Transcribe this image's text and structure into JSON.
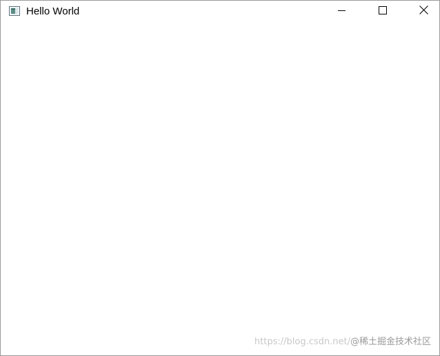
{
  "window": {
    "title": "Hello World",
    "icon": "application-window-icon",
    "controls": {
      "minimize": "minimize-icon",
      "maximize": "maximize-icon",
      "close": "close-icon"
    }
  },
  "watermark": {
    "url": "https://blog.csdn.net/",
    "brand": "@稀土掘金技术社区"
  }
}
